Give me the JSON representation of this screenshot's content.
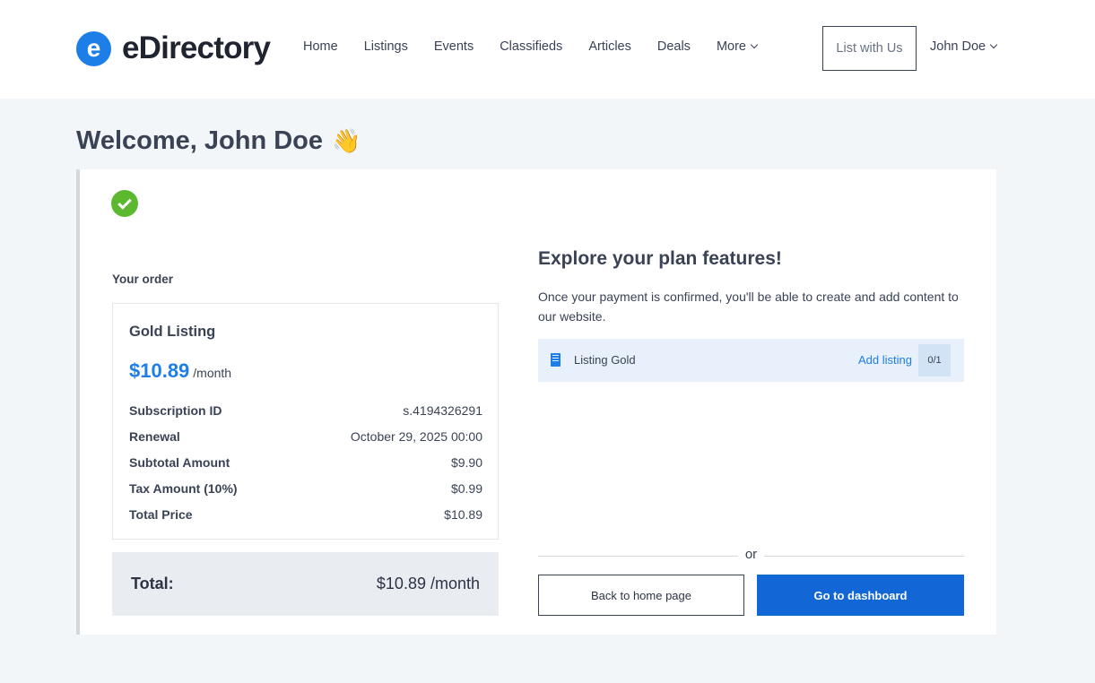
{
  "brand": {
    "logo_letter": "e",
    "name": "eDirectory",
    "accent": "#1e7ee8"
  },
  "nav": {
    "items": [
      "Home",
      "Listings",
      "Events",
      "Classifieds",
      "Articles",
      "Deals"
    ],
    "more_label": "More",
    "list_button": "List with Us",
    "user_name": "John Doe"
  },
  "welcome": {
    "title": "Welcome, John Doe",
    "emoji": "👋"
  },
  "order": {
    "section_label": "Your order",
    "plan_name": "Gold Listing",
    "price": "$10.89",
    "period": "/month",
    "rows": [
      {
        "label": "Subscription ID",
        "value": "s.4194326291"
      },
      {
        "label": "Renewal",
        "value": "October 29, 2025 00:00"
      },
      {
        "label": "Subtotal Amount",
        "value": "$9.90"
      },
      {
        "label": "Tax Amount (10%)",
        "value": "$0.99"
      },
      {
        "label": "Total Price",
        "value": "$10.89"
      }
    ],
    "total_label": "Total:",
    "total_value": "$10.89 /month"
  },
  "explore": {
    "title": "Explore your plan features!",
    "description": "Once your payment is confirmed, you'll be able to create and add content to our website.",
    "feature": {
      "icon": "building-icon",
      "name": "Listing Gold",
      "action": "Add listing",
      "count": "0/1"
    }
  },
  "actions": {
    "or_label": "or",
    "back_label": "Back to home page",
    "dashboard_label": "Go to dashboard"
  },
  "colors": {
    "primary_button": "#1366d6",
    "success": "#5cb82e",
    "feature_bg": "#e7f0fb"
  }
}
